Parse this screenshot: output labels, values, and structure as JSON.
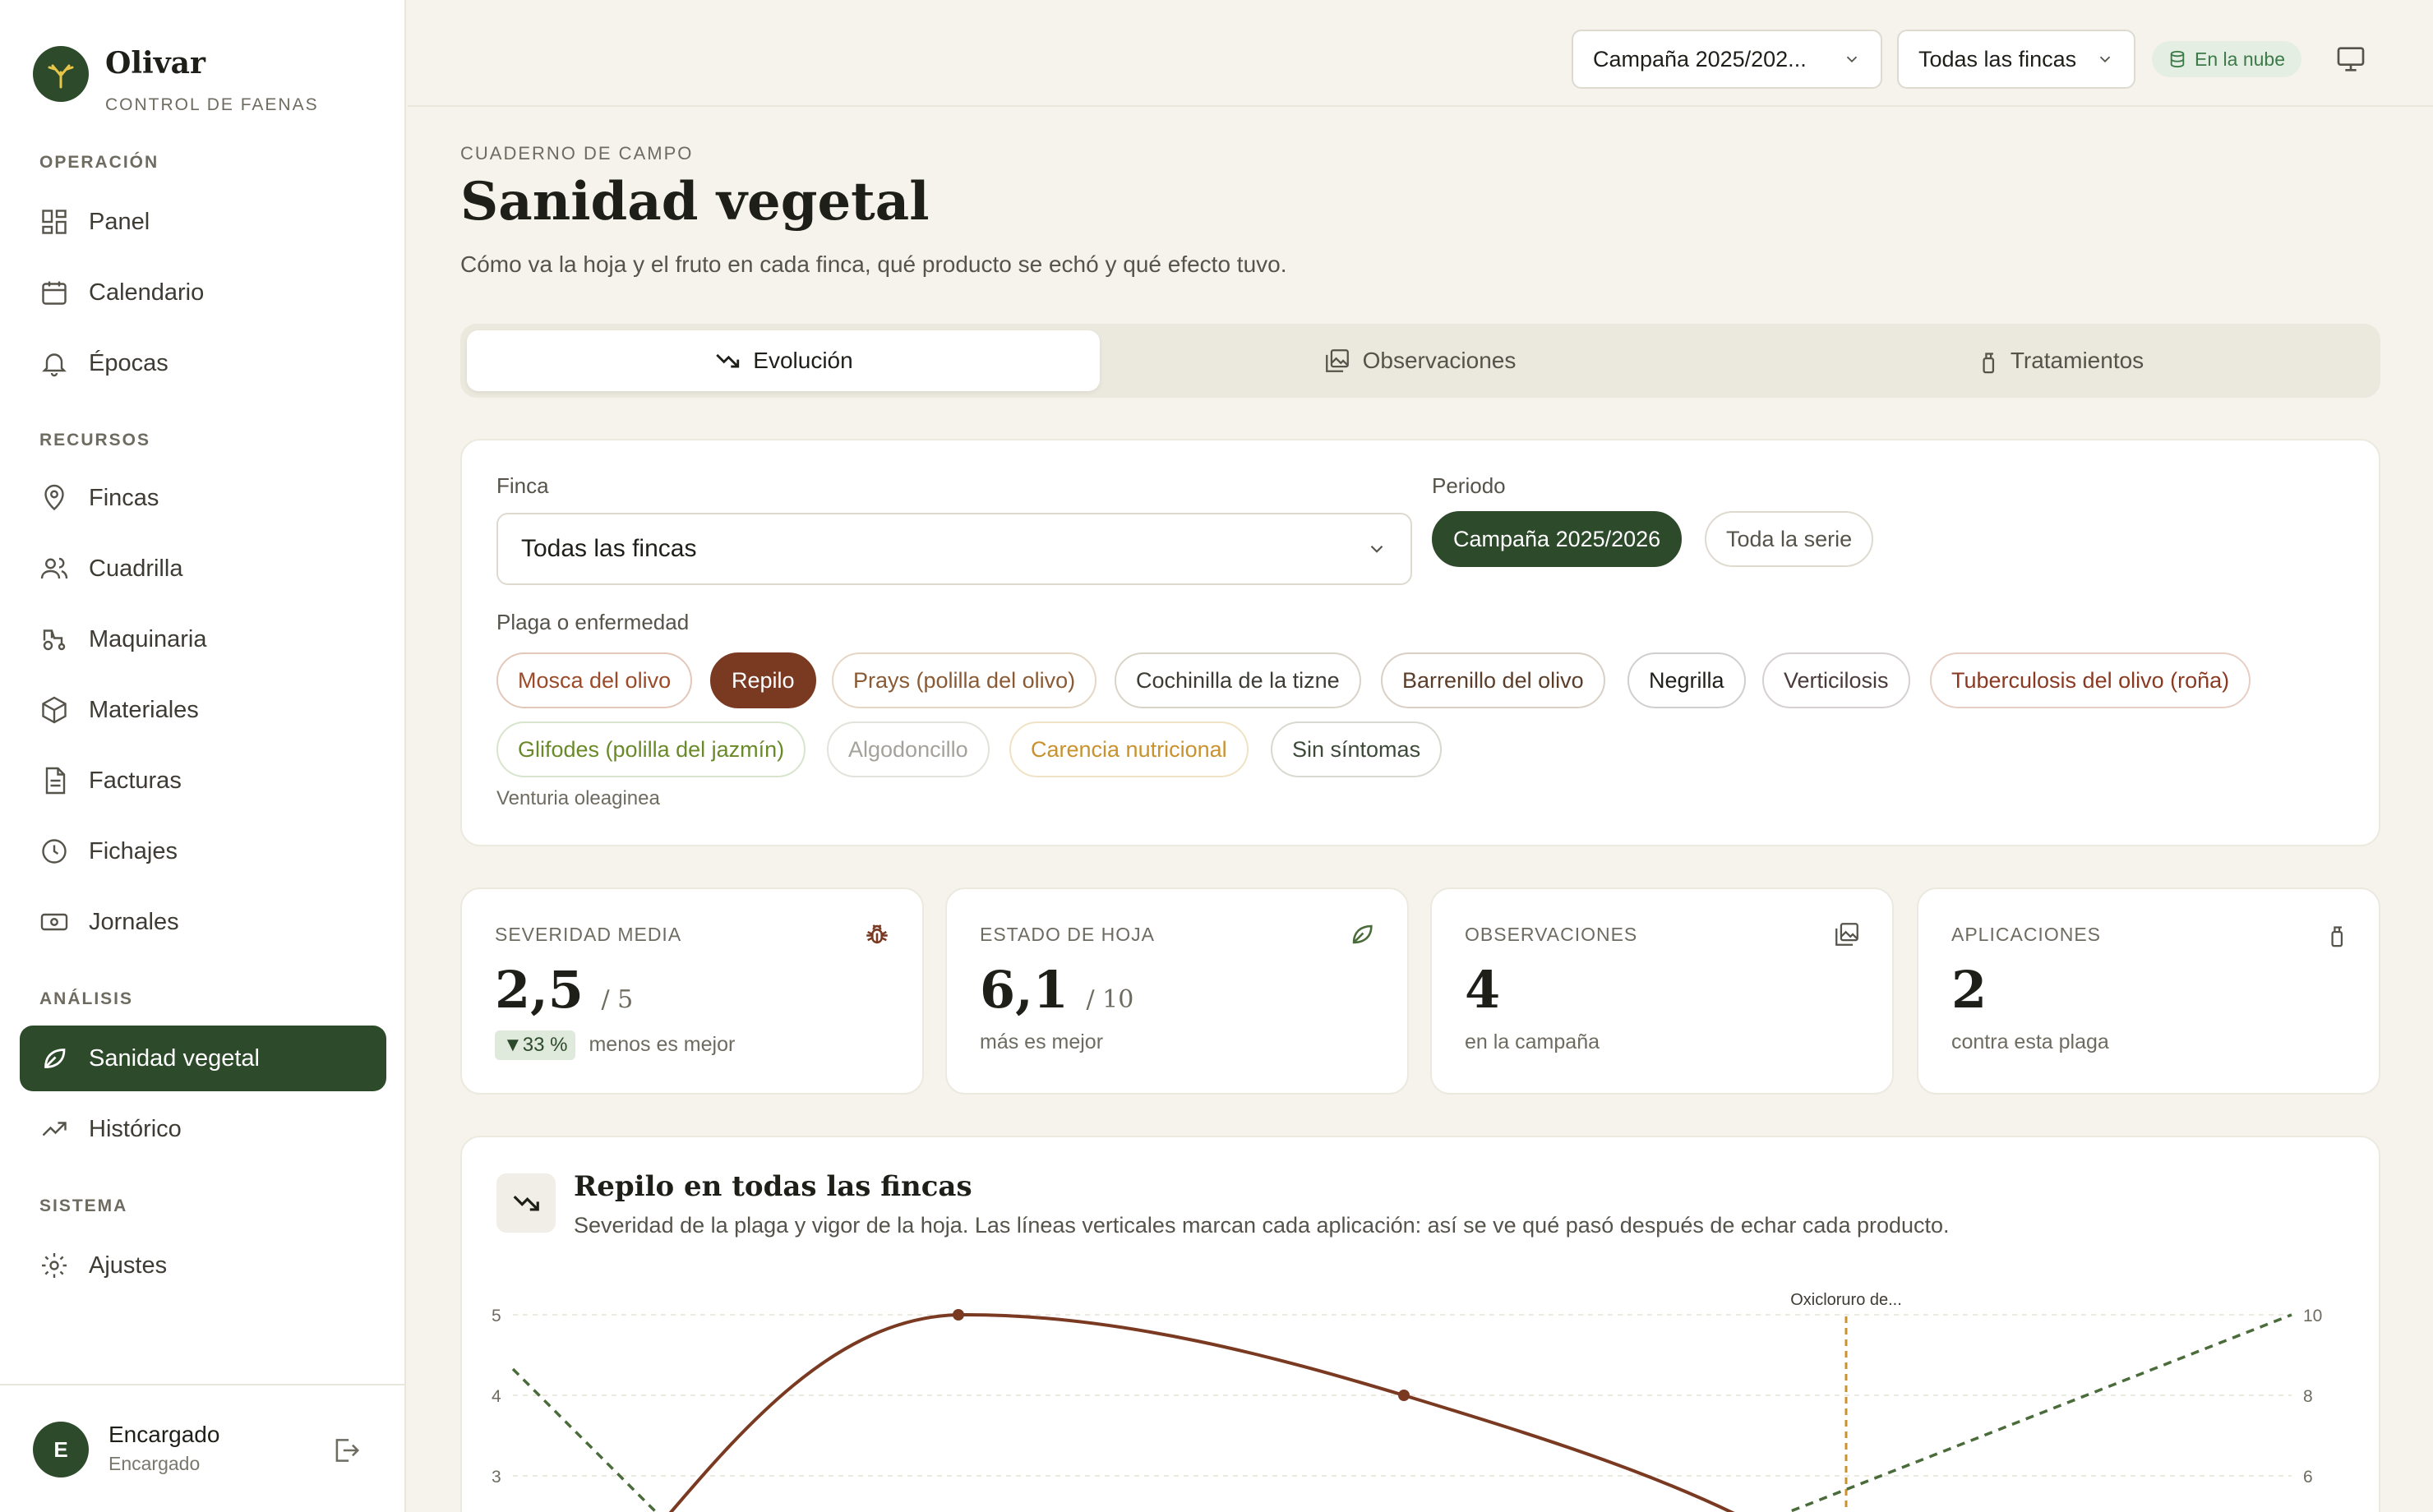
{
  "brand": {
    "name": "Olivar",
    "subtitle": "CONTROL DE FAENAS"
  },
  "nav": {
    "sections": {
      "operacion": "OPERACIÓN",
      "recursos": "RECURSOS",
      "analisis": "ANÁLISIS",
      "sistema": "SISTEMA"
    },
    "items": {
      "panel": "Panel",
      "calendario": "Calendario",
      "epocas": "Épocas",
      "fincas": "Fincas",
      "cuadrilla": "Cuadrilla",
      "maquinaria": "Maquinaria",
      "materiales": "Materiales",
      "facturas": "Facturas",
      "fichajes": "Fichajes",
      "jornales": "Jornales",
      "sanidad": "Sanidad vegetal",
      "historico": "Histórico",
      "ajustes": "Ajustes"
    }
  },
  "user": {
    "initial": "E",
    "name": "Encargado",
    "role": "Encargado"
  },
  "topbar": {
    "campaign_select": "Campaña 2025/202...",
    "finca_select": "Todas las fincas",
    "cloud_status": "En la nube"
  },
  "header": {
    "eyebrow": "CUADERNO DE CAMPO",
    "title": "Sanidad vegetal",
    "description": "Cómo va la hoja y el fruto en cada finca, qué producto se echó y qué efecto tuvo."
  },
  "tabs": {
    "evolucion": "Evolución",
    "observaciones": "Observaciones",
    "tratamientos": "Tratamientos"
  },
  "filters": {
    "finca_label": "Finca",
    "finca_value": "Todas las fincas",
    "periodo_label": "Periodo",
    "periodo_campaign": "Campaña 2025/2026",
    "periodo_all": "Toda la serie",
    "plaga_label": "Plaga o enfermedad",
    "plagas": [
      "Mosca del olivo",
      "Repilo",
      "Prays (polilla del olivo)",
      "Cochinilla de la tizne",
      "Barrenillo del olivo",
      "Negrilla",
      "Verticilosis",
      "Tuberculosis del olivo (roña)",
      "Glifodes (polilla del jazmín)",
      "Algodoncillo",
      "Carencia nutricional",
      "Sin síntomas"
    ],
    "scientific_name": "Venturia oleaginea"
  },
  "stats": {
    "severidad": {
      "label": "SEVERIDAD MEDIA",
      "value": "2,5",
      "denom": "/ 5",
      "delta": "▼33 %",
      "note": "menos es mejor"
    },
    "hoja": {
      "label": "ESTADO DE HOJA",
      "value": "6,1",
      "denom": "/ 10",
      "note": "más es mejor"
    },
    "observaciones": {
      "label": "OBSERVACIONES",
      "value": "4",
      "note": "en la campaña"
    },
    "aplicaciones": {
      "label": "APLICACIONES",
      "value": "2",
      "note": "contra esta plaga"
    }
  },
  "chart_header": {
    "title": "Repilo en todas las fincas",
    "subtitle": "Severidad de la plaga y vigor de la hoja. Las líneas verticales marcan cada aplicación: así se ve qué pasó después de echar cada producto."
  },
  "chart_data": {
    "type": "line",
    "left_ticks": [
      "5",
      "4",
      "3"
    ],
    "right_ticks": [
      "10",
      "8",
      "6"
    ],
    "ylim_left": [
      0,
      5
    ],
    "ylim_right": [
      0,
      10
    ],
    "treatment_label": "Oxicloruro de...",
    "series": [
      {
        "color": "#7a3a22",
        "style": "solid"
      },
      {
        "color": "#4a6b3a",
        "style": "dashed"
      }
    ],
    "colors": {
      "severity": "#7a3a22",
      "leaf": "#4a6b3a",
      "treatment": "#c9922e"
    }
  }
}
